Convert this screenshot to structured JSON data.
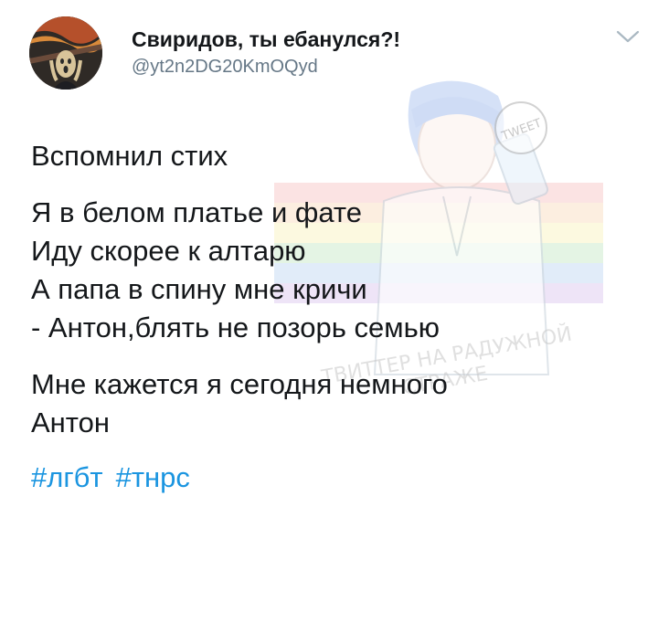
{
  "user": {
    "display_name": "Свиридов, ты ебанулся?!",
    "handle": "@yt2n2DG20KmOQyd"
  },
  "icons": {
    "menu": "chevron-down-icon",
    "avatar": "scream-painting-avatar"
  },
  "tweet": {
    "lines": [
      "Вспомнил стих",
      "Я в белом платье и фате",
      "Иду скорее к алтарю",
      "А папа в спину мне кричи",
      "- Антон,блять не позорь семью",
      "Мне кажется я сегодня немного",
      "Антон"
    ],
    "hashtags": [
      "#лгбт",
      "#тнрс"
    ]
  },
  "watermark": {
    "sticker_text": "TWEET",
    "caption_line1": "ТВИТТЕР НА РАДУЖНОЙ",
    "caption_line2": "СТРАЖЕ"
  },
  "colors": {
    "text": "#14171a",
    "secondary": "#657786",
    "link": "#1b95e0",
    "background": "#ffffff"
  }
}
